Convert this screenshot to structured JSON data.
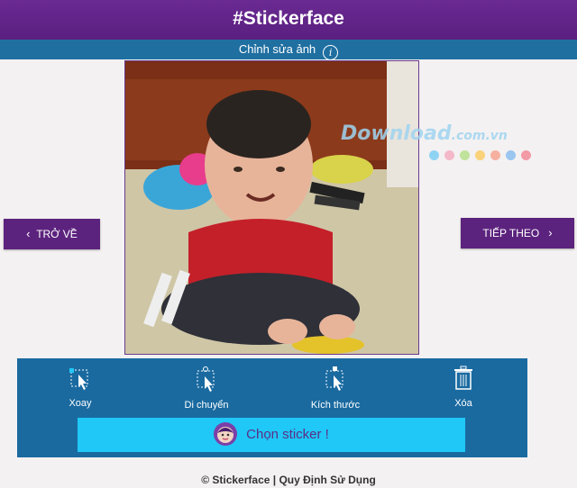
{
  "header": {
    "title": "#Stickerface"
  },
  "subbar": {
    "label": "Chỉnh sửa ảnh",
    "info_icon": "i"
  },
  "nav": {
    "back_label": "TRỞ VỀ",
    "next_label": "TIẾP THEO"
  },
  "toolbar": {
    "tools": [
      {
        "label": "Xoay",
        "icon": "rotate-icon"
      },
      {
        "label": "Di chuyển",
        "icon": "move-icon"
      },
      {
        "label": "Kích thước",
        "icon": "resize-icon"
      },
      {
        "label": "Xóa",
        "icon": "trash-icon"
      }
    ],
    "sticker_button": "Chọn sticker !"
  },
  "footer": {
    "text": "© Stickerface | Quy Định Sử Dụng"
  },
  "watermark": {
    "text": "Download",
    "suffix": ".com.vn"
  },
  "colors": {
    "header": "#5c237e",
    "subbar": "#1f6fa1",
    "toolbar": "#1a6aa0",
    "sticker_button": "#1fc8f6"
  }
}
